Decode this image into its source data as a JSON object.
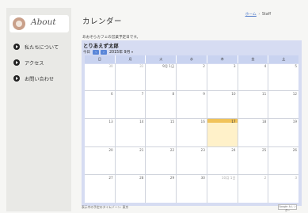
{
  "sidebar": {
    "about_title": "About",
    "items": [
      {
        "label": "私たちについて",
        "icon": "circle-arrow-icon"
      },
      {
        "label": "アクセス",
        "icon": "circle-arrow-icon"
      },
      {
        "label": "お問い合わせ",
        "icon": "circle-arrow-icon"
      }
    ]
  },
  "header": {
    "title": "カレンダー",
    "breadcrumb_home": "ホーム",
    "breadcrumb_sep": "›",
    "breadcrumb_current": "Staff"
  },
  "description": "あおぞらカフェの営業予定日です。",
  "calendar": {
    "title": "とりあえず太郎",
    "today_label": "今日",
    "prev": "‹",
    "next": "›",
    "month_label": "2015年 9月",
    "weekdays": [
      "日",
      "月",
      "火",
      "水",
      "木",
      "金",
      "土"
    ],
    "weeks": [
      [
        "30",
        "31",
        "9月 1日",
        "2",
        "3",
        "4",
        "5"
      ],
      [
        "6",
        "7",
        "8",
        "9",
        "10",
        "11",
        "12"
      ],
      [
        "13",
        "14",
        "15",
        "16",
        "17",
        "18",
        "19"
      ],
      [
        "20",
        "21",
        "22",
        "23",
        "24",
        "25",
        "26"
      ],
      [
        "27",
        "28",
        "29",
        "30",
        "10月 1日",
        "2",
        "3"
      ]
    ],
    "footer_text": "表示中の予定のタイムゾーン: 東京",
    "gcal_badge": "Google カレンダー"
  }
}
